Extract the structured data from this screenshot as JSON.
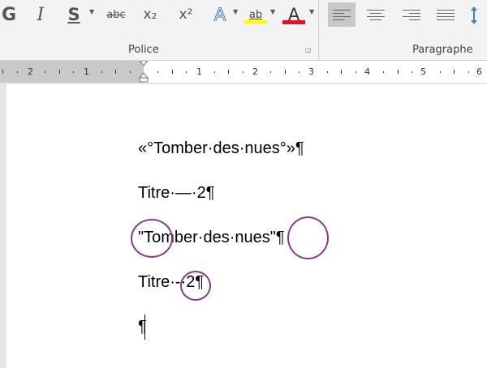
{
  "ribbon": {
    "font_group": {
      "label": "Police",
      "buttons": {
        "bold": "G",
        "italic": "I",
        "underline": "S",
        "strikethrough": "abc",
        "subscript": "x₂",
        "superscript": "x²",
        "text_effects": "A",
        "highlight": "ab",
        "font_color": "A"
      },
      "highlight_color": "#ffff00",
      "font_color_value": "#e81123"
    },
    "paragraph_group": {
      "label": "Paragraphe"
    }
  },
  "ruler": {
    "left_numbers": [
      "2",
      "1"
    ],
    "right_numbers": [
      "1",
      "2",
      "3",
      "4",
      "5",
      "6"
    ]
  },
  "document": {
    "lines": [
      "«°Tomber·des·nues°»¶",
      "Titre·—·2¶",
      "\"Tomber·des·nues\"¶",
      "Titre·-·2¶",
      "¶"
    ]
  },
  "annotation_color": "#8a3a8a"
}
